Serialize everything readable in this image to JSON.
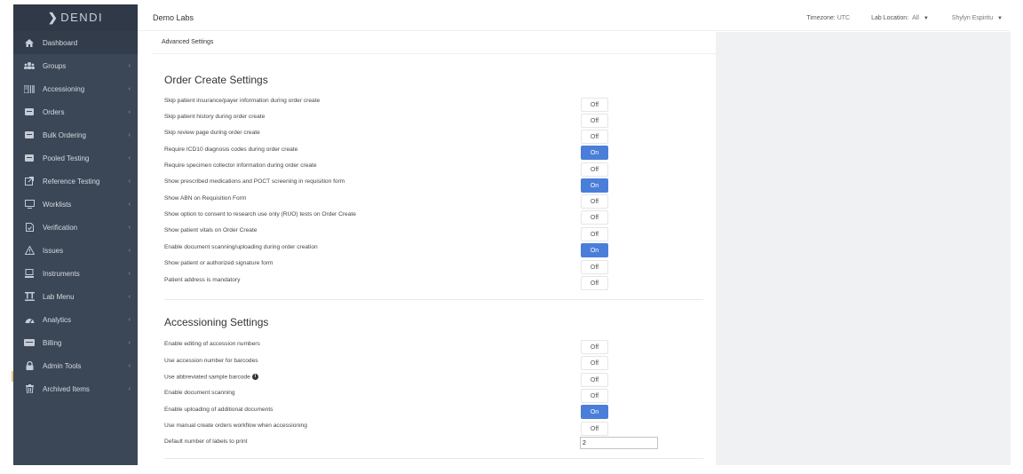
{
  "brand": {
    "logo_text": "DENDI",
    "logo_mark": "❯"
  },
  "header": {
    "title": "Demo Labs",
    "timezone_label": "Timezone:",
    "timezone_value": "UTC",
    "location_label": "Lab Location:",
    "location_value": "All",
    "user_name": "Shylyn Espiritu"
  },
  "sidebar": {
    "items": [
      {
        "label": "Dashboard",
        "icon": "home-icon"
      },
      {
        "label": "Groups",
        "icon": "users-icon"
      },
      {
        "label": "Accessioning",
        "icon": "accessioning-icon"
      },
      {
        "label": "Orders",
        "icon": "orders-icon"
      },
      {
        "label": "Bulk Ordering",
        "icon": "bulk-ordering-icon"
      },
      {
        "label": "Pooled Testing",
        "icon": "pooled-testing-icon"
      },
      {
        "label": "Reference Testing",
        "icon": "external-link-icon"
      },
      {
        "label": "Worklists",
        "icon": "monitor-icon"
      },
      {
        "label": "Verification",
        "icon": "document-check-icon"
      },
      {
        "label": "Issues",
        "icon": "warning-icon"
      },
      {
        "label": "Instruments",
        "icon": "instrument-icon"
      },
      {
        "label": "Lab Menu",
        "icon": "lab-menu-icon"
      },
      {
        "label": "Analytics",
        "icon": "dashboard-gauge-icon"
      },
      {
        "label": "Billing",
        "icon": "billing-icon"
      },
      {
        "label": "Admin Tools",
        "icon": "lock-icon"
      },
      {
        "label": "Archived Items",
        "icon": "trash-icon"
      }
    ]
  },
  "page": {
    "breadcrumb": "Advanced Settings"
  },
  "order_create": {
    "title": "Order Create Settings",
    "rows": [
      {
        "label": "Skip patient insurance/payer information during order create",
        "state": "Off"
      },
      {
        "label": "Skip patient history during order create",
        "state": "Off"
      },
      {
        "label": "Skip review page during order create",
        "state": "Off"
      },
      {
        "label": "Require ICD10 diagnosis codes during order create",
        "state": "On"
      },
      {
        "label": "Require specimen collector information during order create",
        "state": "Off"
      },
      {
        "label": "Show prescribed medications and POCT screening in requisition form",
        "state": "On"
      },
      {
        "label": "Show ABN on Requisition Form",
        "state": "Off"
      },
      {
        "label": "Show option to consent to research use only (RUO) tests on Order Create",
        "state": "Off"
      },
      {
        "label": "Show patient vitals on Order Create",
        "state": "Off"
      },
      {
        "label": "Enable document scanning/uploading during order creation",
        "state": "On"
      },
      {
        "label": "Show patient or authorized signature form",
        "state": "Off"
      },
      {
        "label": "Patient address is mandatory",
        "state": "Off"
      }
    ]
  },
  "accessioning": {
    "title": "Accessioning Settings",
    "rows": [
      {
        "label": "Enable editing of accession numbers",
        "state": "Off"
      },
      {
        "label": "Use accession number for barcodes",
        "state": "Off"
      },
      {
        "label": "Use abbreviated sample barcode",
        "state": "Off"
      },
      {
        "label": "Enable document scanning",
        "state": "Off"
      },
      {
        "label": "Enable uploading of additional documents",
        "state": "On"
      },
      {
        "label": "Use manual create orders workflow when accessioning",
        "state": "Off"
      }
    ],
    "labels_to_print_label": "Default number of labels to print",
    "labels_to_print_value": "2"
  }
}
